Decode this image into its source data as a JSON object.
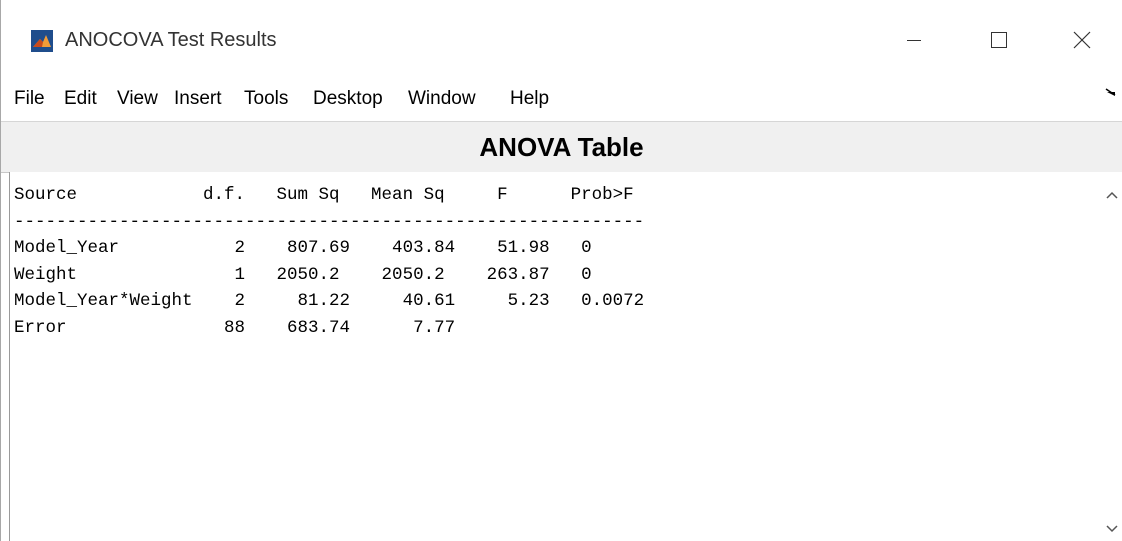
{
  "window": {
    "title": "ANOCOVA Test Results",
    "app_icon": "matlab-icon",
    "controls": {
      "minimize": "minimize-icon",
      "maximize": "maximize-icon",
      "close": "close-icon"
    }
  },
  "menu": {
    "items": [
      "File",
      "Edit",
      "View",
      "Insert",
      "Tools",
      "Desktop",
      "Window",
      "Help"
    ],
    "dock_icon": "dock-arrow-icon"
  },
  "table": {
    "title": "ANOVA Table",
    "lines": [
      "Source            d.f.   Sum Sq   Mean Sq     F      Prob>F",
      "------------------------------------------------------------",
      "Model_Year           2    807.69    403.84    51.98   0",
      "Weight               1   2050.2    2050.2    263.87   0",
      "Model_Year*Weight    2     81.22     40.61     5.23   0.0072",
      "Error               88    683.74      7.77"
    ],
    "columns": [
      "Source",
      "d.f.",
      "Sum Sq",
      "Mean Sq",
      "F",
      "Prob>F"
    ],
    "rows": [
      [
        "Model_Year",
        "2",
        "807.69",
        "403.84",
        "51.98",
        "0"
      ],
      [
        "Weight",
        "1",
        "2050.2",
        "2050.2",
        "263.87",
        "0"
      ],
      [
        "Model_Year*Weight",
        "2",
        "81.22",
        "40.61",
        "5.23",
        "0.0072"
      ],
      [
        "Error",
        "88",
        "683.74",
        "7.77",
        "",
        ""
      ]
    ]
  },
  "scrollbar": {
    "up_icon": "chevron-up-icon",
    "down_icon": "chevron-down-icon"
  }
}
